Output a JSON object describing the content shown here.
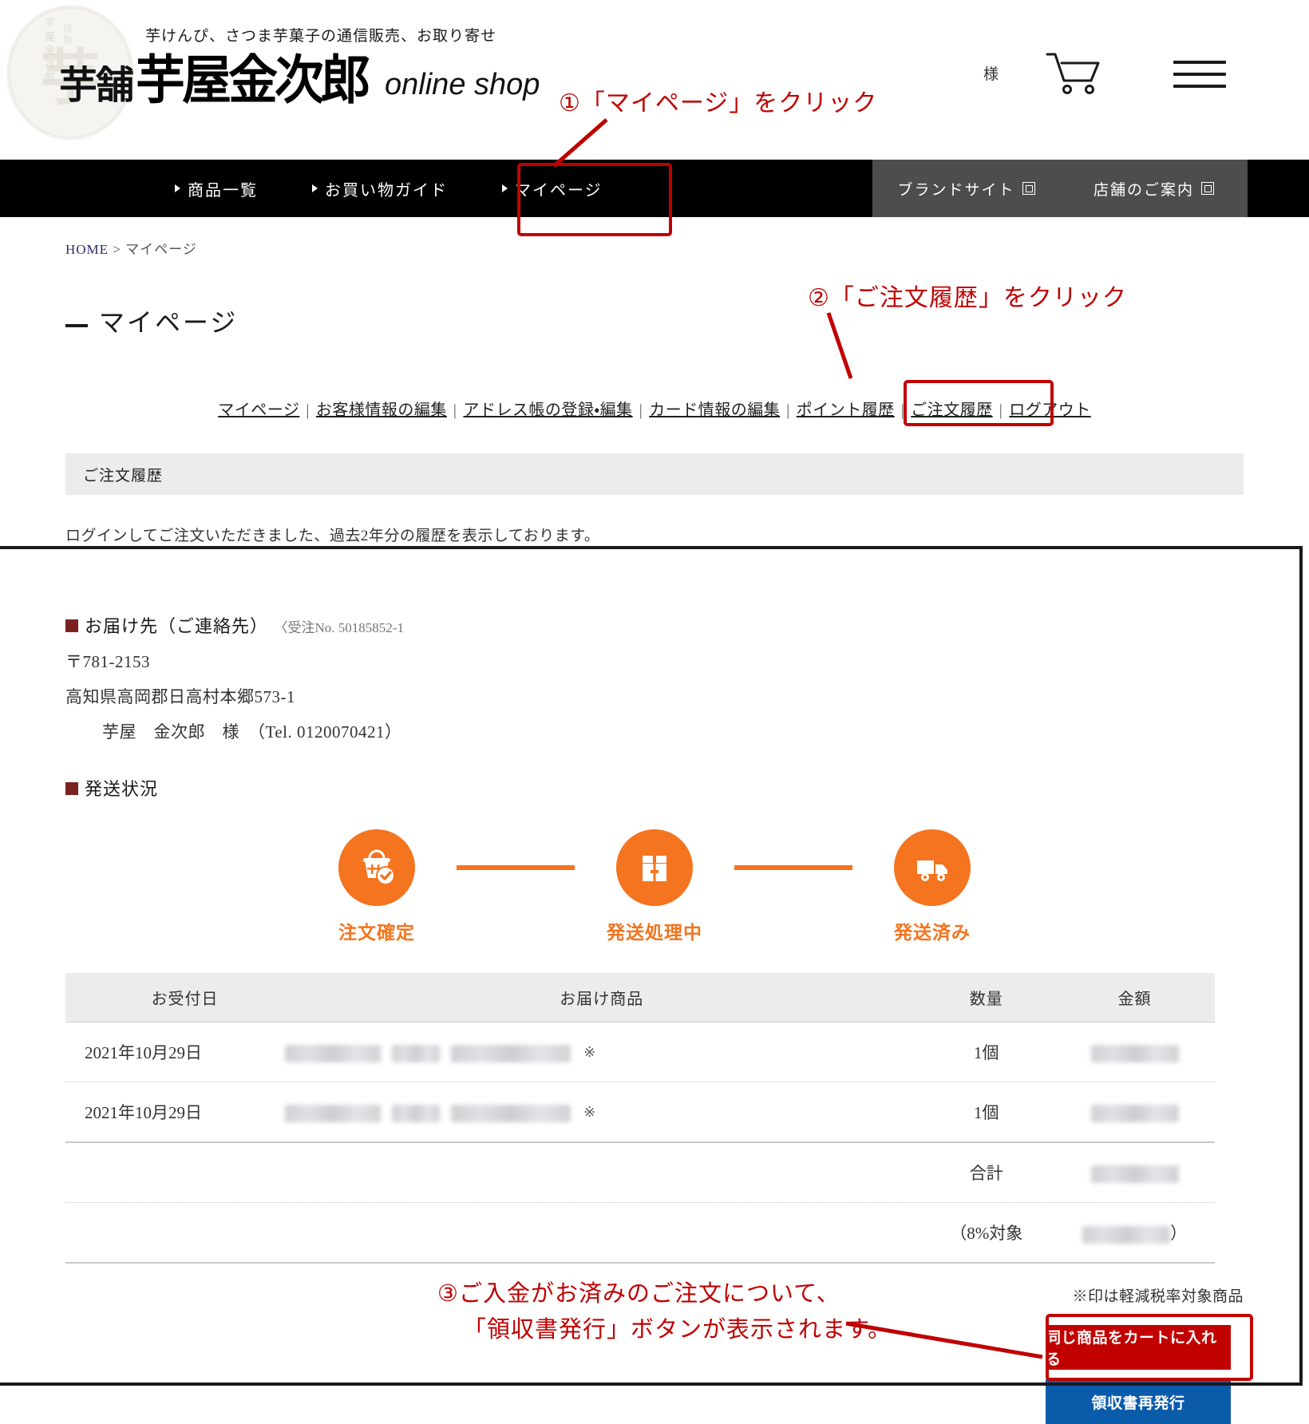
{
  "header": {
    "tagline": "芋けんぴ、さつま芋菓子の通信販売、お取り寄せ",
    "brand_prefix": "芋舗",
    "brand_name": "芋屋金次郎",
    "brand_en": "online shop",
    "stamp_char": "芋",
    "stamp_side": "芋屋金次郎",
    "stamp_side2": "謹製",
    "user_suffix": "様",
    "cart_icon": "cart-icon",
    "menu_icon": "hamburger-menu-icon"
  },
  "global_nav": {
    "left_items": [
      {
        "label": "商品一覧"
      },
      {
        "label": "お買い物ガイド"
      },
      {
        "label": "マイページ"
      }
    ],
    "right_items": [
      {
        "label": "ブランドサイト"
      },
      {
        "label": "店舗のご案内"
      }
    ]
  },
  "breadcrumb": {
    "home": "HOME",
    "separator": ">",
    "current": "マイページ"
  },
  "page_title": "マイページ",
  "mypage_links": [
    "マイページ",
    "お客様情報の編集",
    "アドレス帳の登録・編集",
    "カード情報の編集",
    "ポイント履歴",
    "ご注文履歴",
    "ログアウト"
  ],
  "section": {
    "heading": "ご注文履歴",
    "description": "ログインしてご注文いただきました、過去2年分の履歴を表示しております。"
  },
  "order": {
    "address_heading": "お届け先（ご連絡先）",
    "order_no_label": "〈受注No. 50185852-1",
    "postal": "〒781-2153",
    "address": "高知県高岡郡日高村本郷573-1",
    "recipient": "芋屋　金次郎　様　（Tel. 0120070421）",
    "shipping_heading": "発送状況",
    "steps": [
      {
        "label": "注文確定",
        "icon": "basket-check-icon"
      },
      {
        "label": "発送処理中",
        "icon": "package-box-icon"
      },
      {
        "label": "発送済み",
        "icon": "delivery-truck-icon"
      }
    ],
    "table": {
      "columns": [
        "お受付日",
        "お届け商品",
        "数量",
        "金額"
      ],
      "rows": [
        {
          "date": "2021年10月29日",
          "item": "",
          "item_note": "※",
          "qty": "1個",
          "amount": ""
        },
        {
          "date": "2021年10月29日",
          "item": "",
          "item_note": "※",
          "qty": "1個",
          "amount": ""
        }
      ],
      "total_label": "合計",
      "total_amount": "",
      "tax_label": "（8%対象",
      "tax_amount": "",
      "tax_close": "）"
    },
    "tax_note": "※印は軽減税率対象商品",
    "buttons": {
      "cart": "同じ商品をカートに入れる",
      "receipt": "領収書再発行"
    }
  },
  "annotations": {
    "a1": "①「マイページ」をクリック",
    "a2": "②「ご注文履歴」をクリック",
    "a3_line1": "③ご入金がお済みのご注文について、",
    "a3_line2": "「領収書発行」ボタンが表示されます。"
  },
  "colors": {
    "accent_orange": "#f4741f",
    "annotation_red": "#c00000",
    "cart_button": "#c10000",
    "receipt_button": "#0b5bab",
    "nav_black": "#000000",
    "nav_grey": "#4d4d4d"
  }
}
